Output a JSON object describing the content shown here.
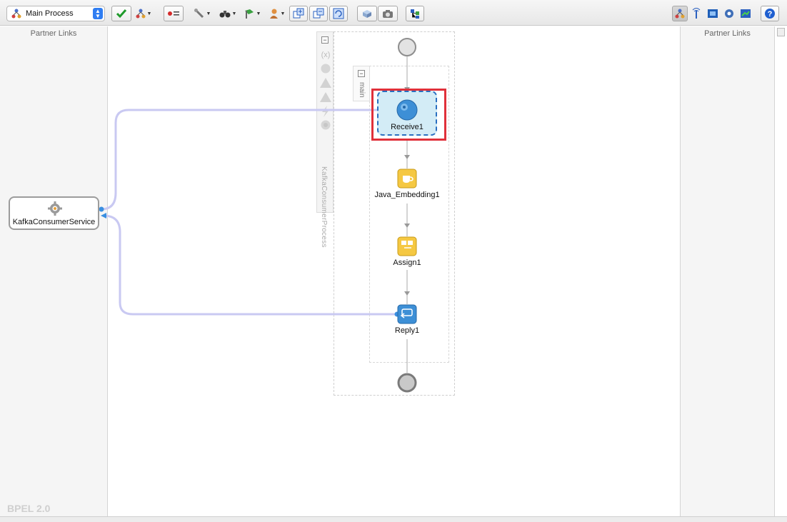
{
  "toolbar": {
    "process_select": {
      "value": "Main Process"
    },
    "buttons": [
      "validate-icon",
      "process-graph-icon",
      "breakpoints-icon",
      "wrench-icon",
      "binoculars-icon",
      "flag-icon",
      "person-icon",
      "expand-all-icon",
      "collapse-all-icon",
      "refresh-icon",
      "cube-icon",
      "camera-icon",
      "tree-icon"
    ],
    "right_buttons": [
      "component-palette-icon",
      "properties-icon",
      "structure-icon",
      "gear-icon",
      "monitor-icon",
      "help-icon"
    ]
  },
  "left_panel": {
    "title": "Partner Links"
  },
  "right_panel": {
    "title": "Partner Links"
  },
  "partner_link": {
    "name": "KafkaConsumerService"
  },
  "process": {
    "scope_label": "KafkaConsumerProcess",
    "sequence_label": "main",
    "activities": [
      {
        "id": "receive",
        "label": "Receive1",
        "type": "receive",
        "selected": true
      },
      {
        "id": "java",
        "label": "Java_Embedding1",
        "type": "java-embedding"
      },
      {
        "id": "assign",
        "label": "Assign1",
        "type": "assign"
      },
      {
        "id": "reply",
        "label": "Reply1",
        "type": "reply"
      }
    ]
  },
  "footer": {
    "version_label": "BPEL 2.0"
  },
  "colors": {
    "accent": "#2f7df2",
    "highlight": "#e0303a",
    "link": "#c9c9f2",
    "selection_fill": "#d3ecf6",
    "activity_yellow": "#f5c842"
  }
}
